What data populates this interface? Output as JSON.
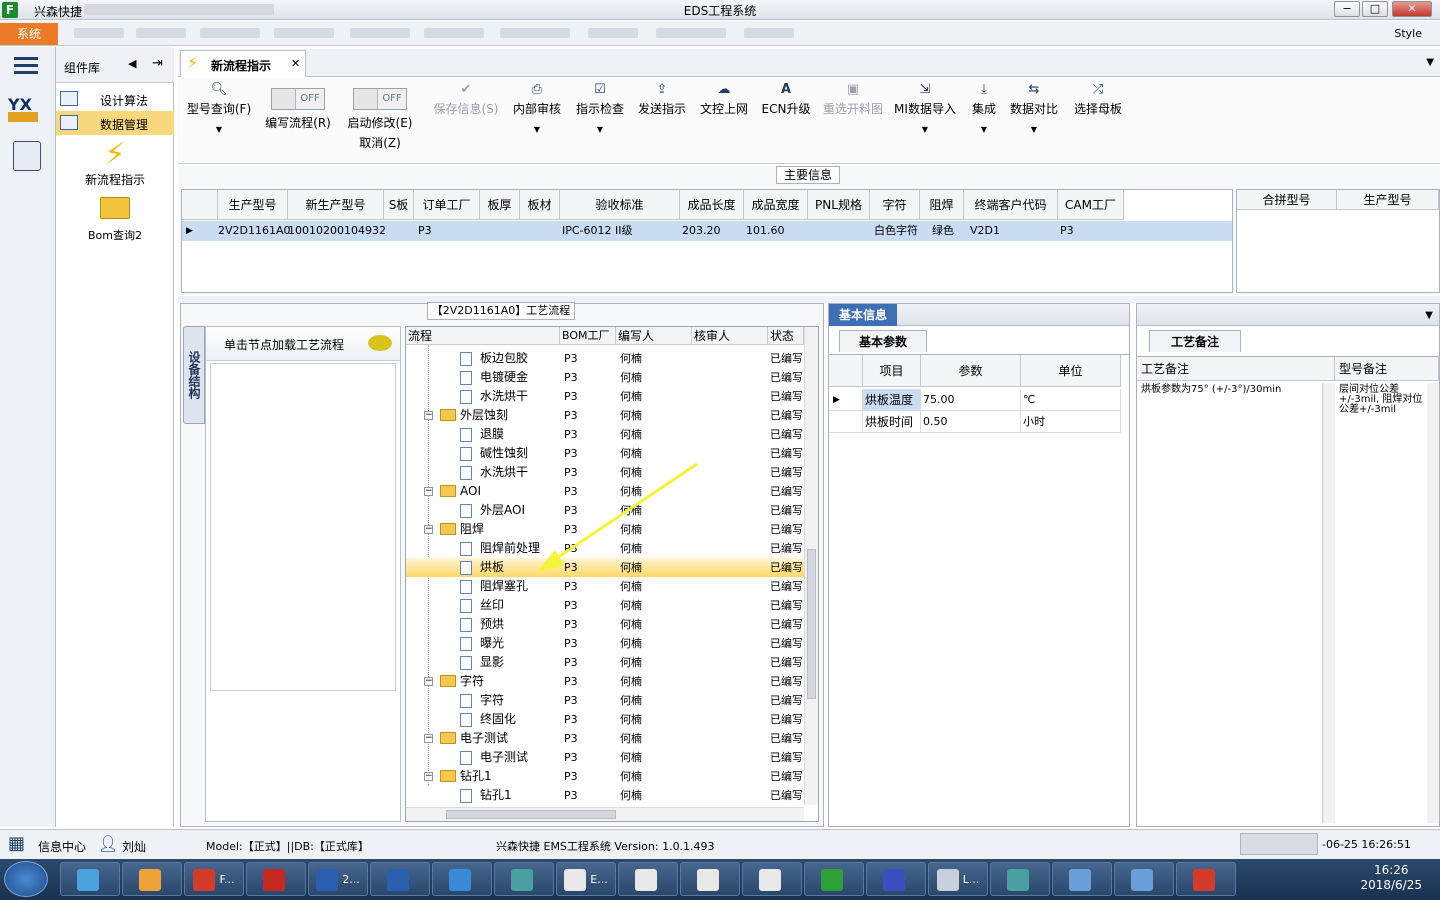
{
  "window": {
    "app_name": "兴森快捷",
    "title": "EDS工程系统",
    "minimize": "−",
    "maximize": "□",
    "close": "✕"
  },
  "menubar": {
    "system": "系统",
    "style": "Style"
  },
  "component_library": {
    "title": "组件库",
    "items": [
      {
        "label": "设计算法"
      },
      {
        "label": "数据管理",
        "selected": true
      }
    ],
    "tools": [
      {
        "label": "新流程指示"
      },
      {
        "label": "Bom查询2"
      }
    ]
  },
  "tab": {
    "label": "新流程指示",
    "close": "✕"
  },
  "toolbar": {
    "model_query": "型号查询(F)",
    "edit_flow_toggle": "OFF",
    "edit_flow": "编写流程(R)",
    "enable_modify_toggle": "OFF",
    "enable_modify": "启动修改(E)",
    "enable_modify_cancel": "取消(Z)",
    "save_info": "保存信息(S)",
    "internal_review": "内部审核",
    "instruction_check": "指示检查",
    "send_instruction": "发送指示",
    "doc_upload": "文控上网",
    "ecn_upgrade": "ECN升级",
    "reselect_material": "重选开料图",
    "mi_import": "MI数据导入",
    "integrate": "集成",
    "data_compare": "数据对比",
    "select_mother": "选择母板"
  },
  "main_info": {
    "label": "主要信息",
    "columns": [
      "生产型号",
      "新生产型号",
      "S板",
      "订单工厂",
      "板厚",
      "板材",
      "验收标准",
      "成品长度",
      "成品宽度",
      "PNL规格",
      "字符",
      "阻焊",
      "终端客户代码",
      "CAM工厂"
    ],
    "row": [
      "2V2D1161A0",
      "10010200104932",
      "",
      "P3",
      "",
      "",
      "IPC-6012 II级",
      "203.20",
      "101.60",
      "",
      "白色字符",
      "绿色",
      "V2D1",
      "P3"
    ],
    "side_columns": [
      "合拼型号",
      "生产型号"
    ]
  },
  "process": {
    "label": "【2V2D1161A0】工艺流程",
    "side_tab": "设备结构",
    "load_hint": "单击节点加载工艺流程",
    "columns": [
      "流程",
      "BOM工厂",
      "编写人",
      "核审人",
      "状态"
    ],
    "rows": [
      {
        "name": "板边包胶",
        "level": 2,
        "folder": false,
        "bom": "P3",
        "author": "何楠",
        "status": "已编写"
      },
      {
        "name": "电镀硬金",
        "level": 2,
        "folder": false,
        "bom": "P3",
        "author": "何楠",
        "status": "已编写"
      },
      {
        "name": "水洗烘干",
        "level": 2,
        "folder": false,
        "bom": "P3",
        "author": "何楠",
        "status": "已编写"
      },
      {
        "name": "外层蚀刻",
        "level": 1,
        "folder": true,
        "bom": "P3",
        "author": "何楠",
        "status": "已编写"
      },
      {
        "name": "退膜",
        "level": 2,
        "folder": false,
        "bom": "P3",
        "author": "何楠",
        "status": "已编写"
      },
      {
        "name": "碱性蚀刻",
        "level": 2,
        "folder": false,
        "bom": "P3",
        "author": "何楠",
        "status": "已编写"
      },
      {
        "name": "水洗烘干",
        "level": 2,
        "folder": false,
        "bom": "P3",
        "author": "何楠",
        "status": "已编写"
      },
      {
        "name": "AOI",
        "level": 1,
        "folder": true,
        "bom": "P3",
        "author": "何楠",
        "status": "已编写"
      },
      {
        "name": "外层AOI",
        "level": 2,
        "folder": false,
        "bom": "P3",
        "author": "何楠",
        "status": "已编写"
      },
      {
        "name": "阻焊",
        "level": 1,
        "folder": true,
        "bom": "P3",
        "author": "何楠",
        "status": "已编写"
      },
      {
        "name": "阻焊前处理",
        "level": 2,
        "folder": false,
        "bom": "P3",
        "author": "何楠",
        "status": "已编写"
      },
      {
        "name": "烘板",
        "level": 2,
        "folder": false,
        "bom": "P3",
        "author": "何楠",
        "status": "已编写",
        "selected": true
      },
      {
        "name": "阻焊塞孔",
        "level": 2,
        "folder": false,
        "bom": "P3",
        "author": "何楠",
        "status": "已编写"
      },
      {
        "name": "丝印",
        "level": 2,
        "folder": false,
        "bom": "P3",
        "author": "何楠",
        "status": "已编写"
      },
      {
        "name": "预烘",
        "level": 2,
        "folder": false,
        "bom": "P3",
        "author": "何楠",
        "status": "已编写"
      },
      {
        "name": "曝光",
        "level": 2,
        "folder": false,
        "bom": "P3",
        "author": "何楠",
        "status": "已编写"
      },
      {
        "name": "显影",
        "level": 2,
        "folder": false,
        "bom": "P3",
        "author": "何楠",
        "status": "已编写"
      },
      {
        "name": "字符",
        "level": 1,
        "folder": true,
        "bom": "P3",
        "author": "何楠",
        "status": "已编写"
      },
      {
        "name": "字符",
        "level": 2,
        "folder": false,
        "bom": "P3",
        "author": "何楠",
        "status": "已编写"
      },
      {
        "name": "终固化",
        "level": 2,
        "folder": false,
        "bom": "P3",
        "author": "何楠",
        "status": "已编写"
      },
      {
        "name": "电子测试",
        "level": 1,
        "folder": true,
        "bom": "P3",
        "author": "何楠",
        "status": "已编写"
      },
      {
        "name": "电子测试",
        "level": 2,
        "folder": false,
        "bom": "P3",
        "author": "何楠",
        "status": "已编写"
      },
      {
        "name": "钻孔1",
        "level": 1,
        "folder": true,
        "bom": "P3",
        "author": "何楠",
        "status": "已编写"
      },
      {
        "name": "钻孔1",
        "level": 2,
        "folder": false,
        "bom": "P3",
        "author": "何楠",
        "status": "已编写"
      }
    ]
  },
  "basic_info": {
    "title": "基本信息",
    "params_tab": "基本参数",
    "columns": [
      "项目",
      "参数",
      "单位"
    ],
    "rows": [
      {
        "item": "烘板温度",
        "value": "75.00",
        "unit": "℃"
      },
      {
        "item": "烘板时间",
        "value": "0.50",
        "unit": "小时"
      }
    ]
  },
  "process_notes": {
    "tab": "工艺备注",
    "columns": [
      "工艺备注",
      "型号备注"
    ],
    "process_note": "烘板参数为75° (+/-3°)/30min",
    "model_note": "层间对位公差+/-3mil, 阻焊对位公差+/-3mil"
  },
  "statusbar": {
    "info_center": "信息中心",
    "user": "刘灿",
    "model": "Model:【正式】||DB:【正式库】",
    "version": "兴森快捷 EMS工程系统 Version: 1.0.1.493",
    "datetime": "-06-25 16:26:51"
  },
  "taskbar": {
    "items": [
      "",
      "",
      "F...",
      "",
      "2...",
      "",
      "",
      "",
      "E...",
      "",
      "",
      "",
      "",
      "",
      "L...",
      "",
      "",
      "",
      ""
    ],
    "time": "16:26",
    "date": "2018/6/25"
  },
  "colors": {
    "accent": "#3d6fb2",
    "system_menu": "#ec7a26",
    "selected_row": "#fcd867",
    "grid_selected": "#c9dcf2"
  }
}
